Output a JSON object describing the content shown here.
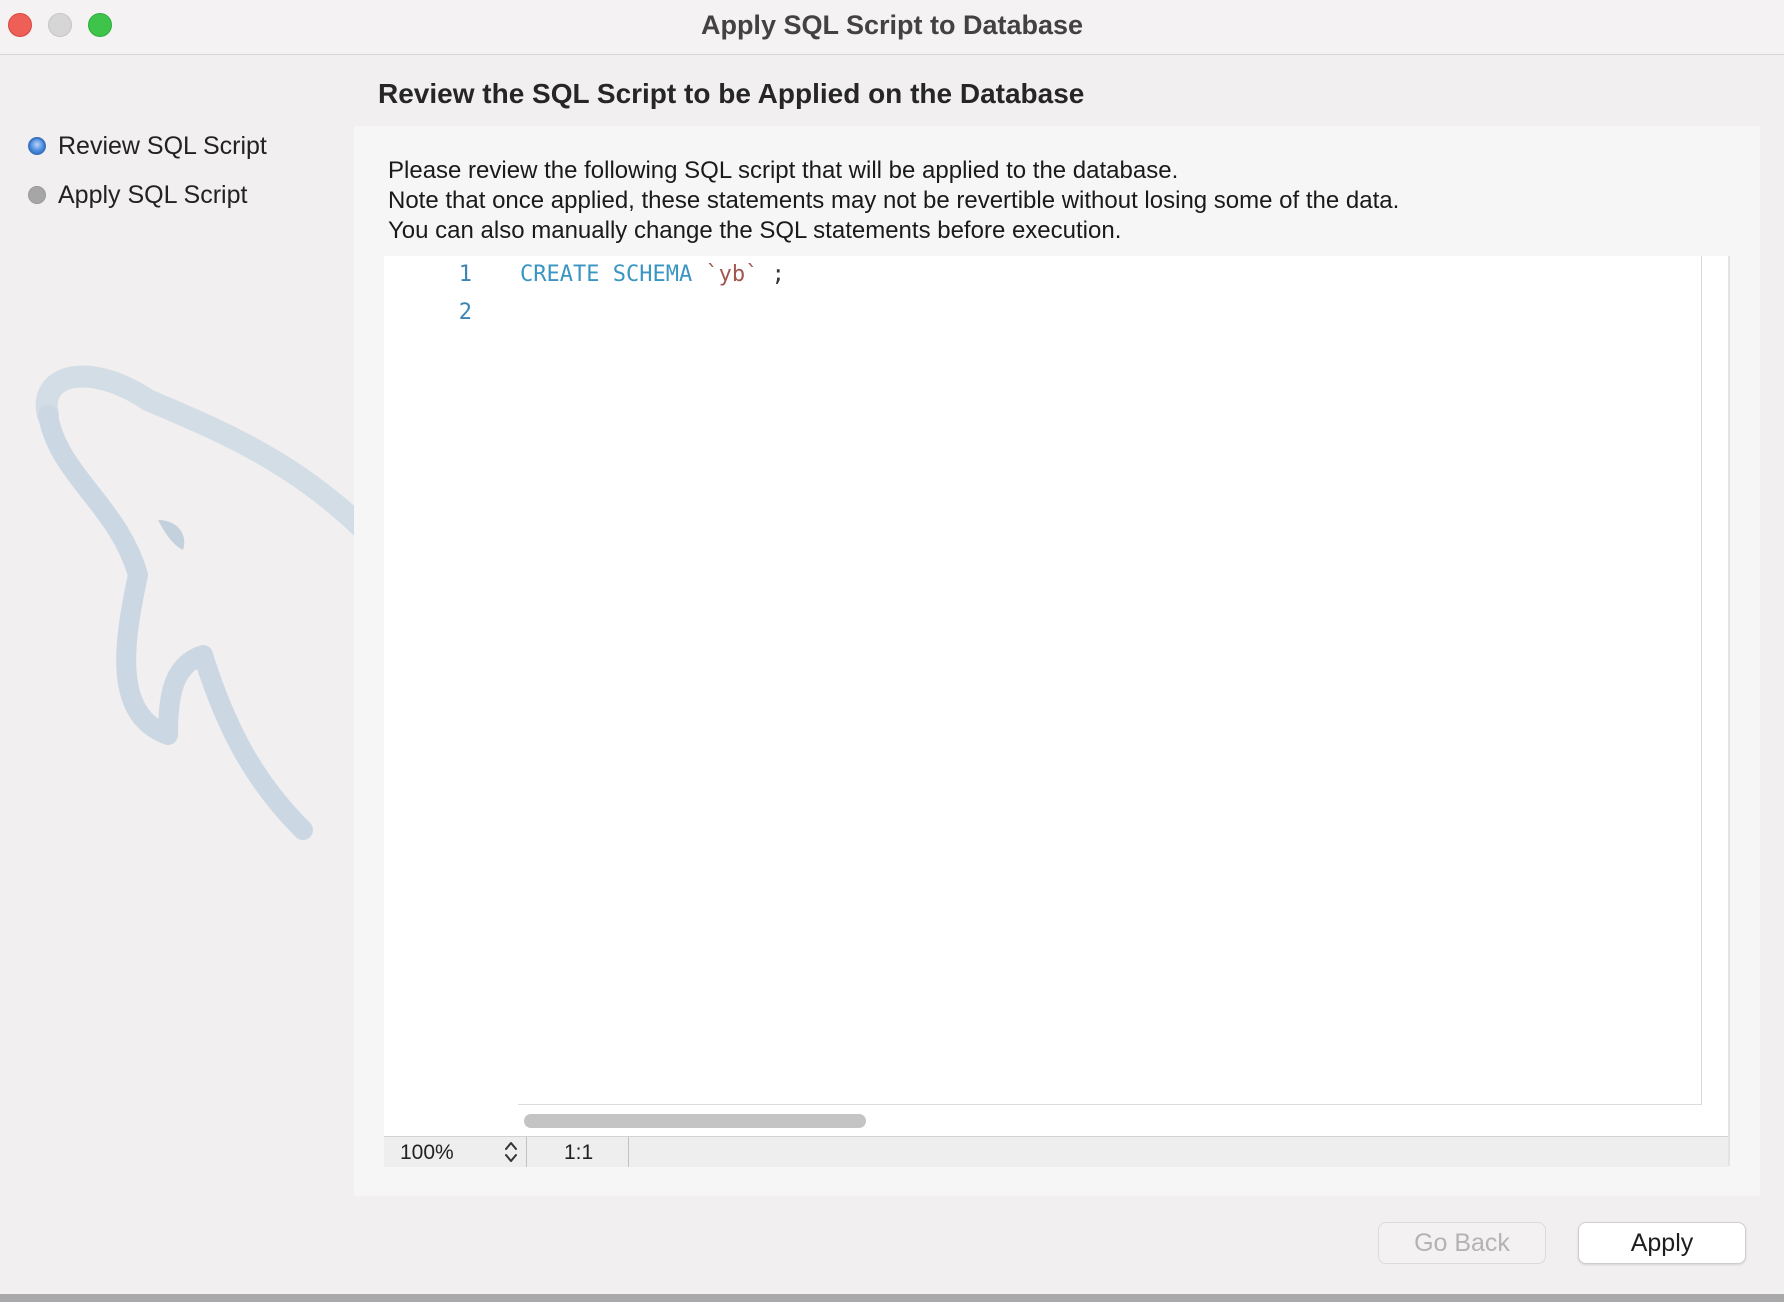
{
  "window": {
    "title": "Apply SQL Script to Database"
  },
  "sidebar": {
    "steps": [
      {
        "label": "Review SQL Script",
        "active": true
      },
      {
        "label": "Apply SQL Script",
        "active": false
      }
    ]
  },
  "main": {
    "title": "Review the SQL Script to be Applied on the Database",
    "description": [
      "Please review the following SQL script that will be applied to the database.",
      "Note that once applied, these statements may not be revertible without losing some of the data.",
      "You can also manually change the SQL statements before execution."
    ],
    "editor": {
      "lines": [
        {
          "number": "1",
          "keyword": "CREATE SCHEMA",
          "identifier": "`yb`",
          "terminator": ";"
        },
        {
          "number": "2",
          "keyword": "",
          "identifier": "",
          "terminator": ""
        }
      ],
      "zoom": "100%",
      "cursor_position": "1:1"
    }
  },
  "buttons": {
    "go_back": "Go Back",
    "apply": "Apply"
  },
  "colors": {
    "keyword": "#3a95c2",
    "identifier": "#a0564f",
    "line_number": "#3c84b4",
    "active_step": "#4f8fe0"
  }
}
